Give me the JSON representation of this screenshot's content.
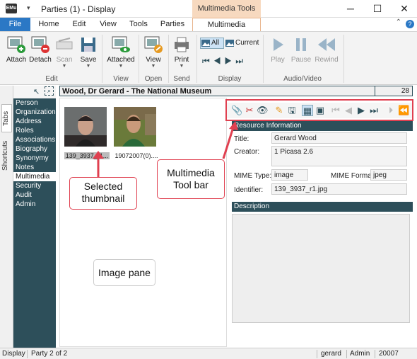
{
  "window": {
    "title": "Parties (1) - Display",
    "logo_text": "EMu",
    "context_tab_header": "Multimedia Tools",
    "qa_arrow": "▾",
    "minimize": "─",
    "maximize": "☐",
    "close": "✕"
  },
  "ribbon_tabs": [
    "File",
    "Home",
    "Edit",
    "View",
    "Tools",
    "Parties",
    "Multimedia"
  ],
  "ribbon": {
    "buttons": {
      "attach": "Attach",
      "detach": "Detach",
      "scan": "Scan",
      "save": "Save",
      "attached": "Attached",
      "view": "View",
      "print": "Print",
      "all": "All",
      "current": "Current",
      "play": "Play",
      "pause": "Pause",
      "rewind": "Rewind"
    },
    "groups": {
      "edit": "Edit",
      "view": "View",
      "open": "Open",
      "send": "Send",
      "display": "Display",
      "audio_video": "Audio/Video"
    }
  },
  "side_tabs": {
    "tabs": "Tabs",
    "shortcuts": "Shortcuts"
  },
  "nav_items": [
    "Person",
    "Organization",
    "Address",
    "Roles",
    "Associations",
    "Biography",
    "Synonymy",
    "Notes",
    "Multimedia",
    "Security",
    "Audit",
    "Admin"
  ],
  "nav_selected": "Multimedia",
  "record": {
    "title": "Wood, Dr Gerard - The National Museum",
    "number": "28"
  },
  "thumbnails": [
    {
      "caption": "139_3937_r1...",
      "selected": true
    },
    {
      "caption": "19072007(0)....",
      "selected": false
    }
  ],
  "resource": {
    "header": "Resource Information",
    "title_label": "Title:",
    "title_value": "Gerard Wood",
    "creator_label": "Creator:",
    "creator_value": "1  Picasa 2.6",
    "mime_type_label": "MIME Type:",
    "mime_type_value": "image",
    "mime_format_label": "MIME Format:",
    "mime_format_value": "jpeg",
    "identifier_label": "Identifier:",
    "identifier_value": "139_3937_r1.jpg"
  },
  "description": {
    "header": "Description"
  },
  "callouts": {
    "selected_thumbnail": "Selected thumbnail",
    "multimedia_toolbar": "Multimedia Tool bar",
    "image_pane": "Image pane"
  },
  "status": {
    "mode": "Display",
    "position": "Party 2 of 2",
    "user": "gerard",
    "group": "Admin",
    "irn": "20007"
  },
  "colors": {
    "nav_bg": "#2d4f5a",
    "file_tab": "#2b78c5",
    "context_tab": "#f7d9bf",
    "callout_border": "#e04050"
  }
}
